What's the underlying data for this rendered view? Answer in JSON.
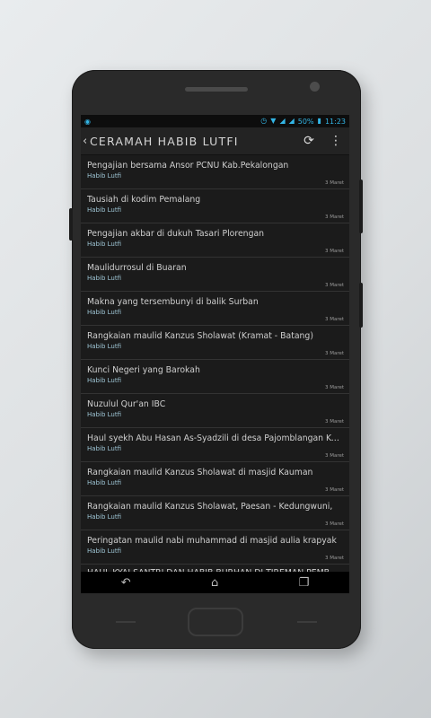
{
  "status": {
    "left_icon": "notification-icon",
    "battery": "50%",
    "time": "11:23"
  },
  "appbar": {
    "title": "CERAMAH HABIB LUTFI",
    "back_icon": "back-chevron-icon",
    "refresh_icon": "refresh-icon",
    "overflow_icon": "overflow-menu-icon"
  },
  "items": [
    {
      "title": "Pengajian bersama Ansor PCNU Kab.Pekalongan",
      "author": "Habib Lutfi",
      "date": "3 Maret"
    },
    {
      "title": "Tausiah di kodim Pemalang",
      "author": "Habib Lutfi",
      "date": "3 Maret"
    },
    {
      "title": "Pengajian akbar di dukuh Tasari Plorengan",
      "author": "Habib Lutfi",
      "date": "3 Maret"
    },
    {
      "title": "Maulidurrosul di Buaran",
      "author": "Habib Lutfi",
      "date": "3 Maret"
    },
    {
      "title": "Makna yang tersembunyi di balik Surban",
      "author": "Habib Lutfi",
      "date": "3 Maret"
    },
    {
      "title": "Rangkaian maulid Kanzus Sholawat (Kramat - Batang)",
      "author": "Habib Lutfi",
      "date": "3 Maret"
    },
    {
      "title": "Kunci Negeri yang Barokah",
      "author": "Habib Lutfi",
      "date": "3 Maret"
    },
    {
      "title": "Nuzulul Qur'an IBC",
      "author": "Habib Lutfi",
      "date": "3 Maret"
    },
    {
      "title": "Haul syekh Abu Hasan As-Syadzili di desa Pajomblangan Kedungwuni...",
      "author": "Habib Lutfi",
      "date": "3 Maret"
    },
    {
      "title": "Rangkaian maulid Kanzus Sholawat di masjid Kauman",
      "author": "Habib Lutfi",
      "date": "3 Maret"
    },
    {
      "title": "Rangkaian maulid Kanzus Sholawat, Paesan - Kedungwuni,",
      "author": "Habib Lutfi",
      "date": "3 Maret"
    },
    {
      "title": "Peringatan maulid nabi muhammad di masjid aulia krapyak",
      "author": "Habib Lutfi",
      "date": "3 Maret"
    },
    {
      "title": "HAUL KYAI SANTRI DAN HABIB BURHAN DI TIREMAN PEMBANG",
      "author": "",
      "date": ""
    }
  ],
  "nav": {
    "back": "back-nav-icon",
    "home": "home-nav-icon",
    "recents": "recents-nav-icon"
  }
}
